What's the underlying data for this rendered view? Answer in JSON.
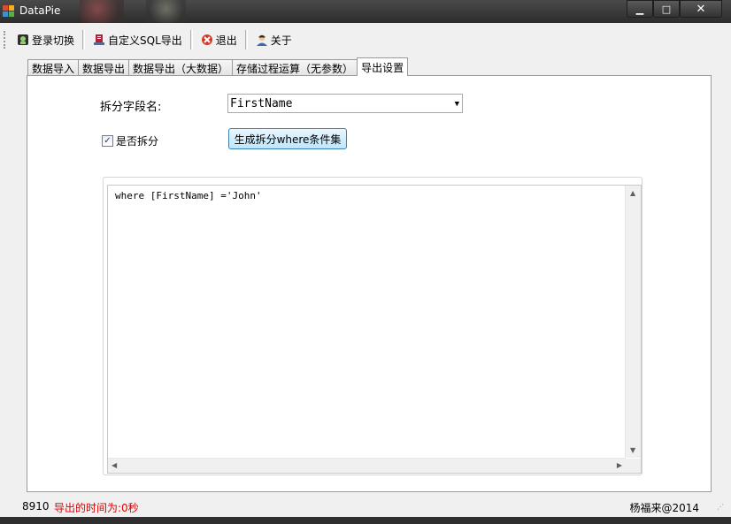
{
  "window": {
    "title": "DataPie",
    "minimize_label": "▁",
    "maximize_label": "□",
    "close_label": "✕"
  },
  "toolbar": {
    "items": [
      {
        "label": "登录切换",
        "icon": "login-icon"
      },
      {
        "label": "自定义SQL导出",
        "icon": "sql-export-icon"
      },
      {
        "label": "退出",
        "icon": "exit-icon"
      },
      {
        "label": "关于",
        "icon": "about-user-icon"
      }
    ]
  },
  "tabs": [
    {
      "label": "数据导入",
      "active": false
    },
    {
      "label": "数据导出",
      "active": false
    },
    {
      "label": "数据导出（大数据）",
      "active": false
    },
    {
      "label": "存储过程运算（无参数）",
      "active": false
    },
    {
      "label": "导出设置",
      "active": true
    }
  ],
  "export_settings": {
    "split_field_label": "拆分字段名:",
    "split_field_value": "FirstName",
    "split_checkbox_label": "是否拆分",
    "split_checked": true,
    "generate_button_label": "生成拆分where条件集",
    "where_text": "where [FirstName] ='John'"
  },
  "status": {
    "count": "8910",
    "message": "导出的时间为:0秒",
    "copyright": "杨福来@2014"
  },
  "colors": {
    "status_message": "#e00000",
    "button_border": "#3c7fb1"
  }
}
